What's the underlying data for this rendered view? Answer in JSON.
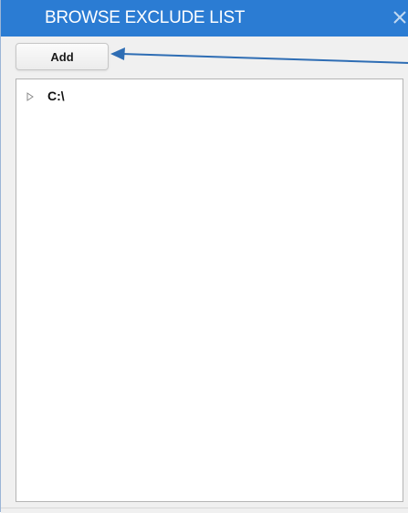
{
  "window": {
    "title": "BROWSE EXCLUDE LIST"
  },
  "toolbar": {
    "add_label": "Add"
  },
  "tree": {
    "items": [
      {
        "label": "C:\\",
        "expanded": false
      }
    ]
  },
  "icons": {
    "close": "close-icon",
    "expand": "chevron-right-icon"
  },
  "colors": {
    "titlebar": "#2b7cd3",
    "annotation_arrow": "#2e6db4"
  }
}
